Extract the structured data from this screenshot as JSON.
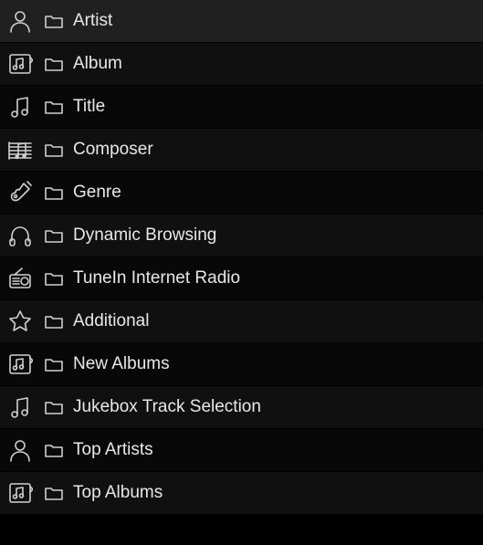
{
  "menu": {
    "items": [
      {
        "label": "Artist",
        "icon": "person-icon"
      },
      {
        "label": "Album",
        "icon": "album-icon"
      },
      {
        "label": "Title",
        "icon": "note-icon"
      },
      {
        "label": "Composer",
        "icon": "composer-icon"
      },
      {
        "label": "Genre",
        "icon": "guitar-icon"
      },
      {
        "label": "Dynamic Browsing",
        "icon": "headphones-icon"
      },
      {
        "label": "TuneIn Internet Radio",
        "icon": "radio-icon"
      },
      {
        "label": "Additional",
        "icon": "star-icon"
      },
      {
        "label": "New Albums",
        "icon": "album-icon"
      },
      {
        "label": "Jukebox Track Selection",
        "icon": "note-icon"
      },
      {
        "label": "Top Artists",
        "icon": "person-icon"
      },
      {
        "label": "Top Albums",
        "icon": "album-icon"
      }
    ]
  }
}
